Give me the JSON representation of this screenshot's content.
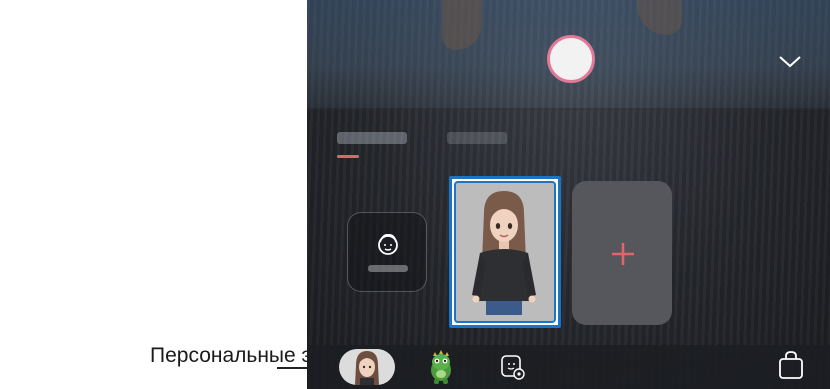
{
  "annotation": {
    "callout_text": "Персональные эмодзи"
  },
  "camera": {
    "shutter": "shutter-button",
    "collapse": "chevron-down-icon"
  },
  "tabs": [
    {
      "label": ""
    },
    {
      "label": ""
    }
  ],
  "cards": {
    "custom_label": "",
    "add_symbol": "+"
  },
  "bottom_nav": {
    "items": [
      "my-emoji-avatar-icon",
      "dino-icon",
      "sticker-settings-icon",
      "bag-icon"
    ]
  },
  "colors": {
    "accent_pink": "#e5646c",
    "selection_blue": "#1b74c4",
    "shutter_ring": "#e07a98"
  }
}
